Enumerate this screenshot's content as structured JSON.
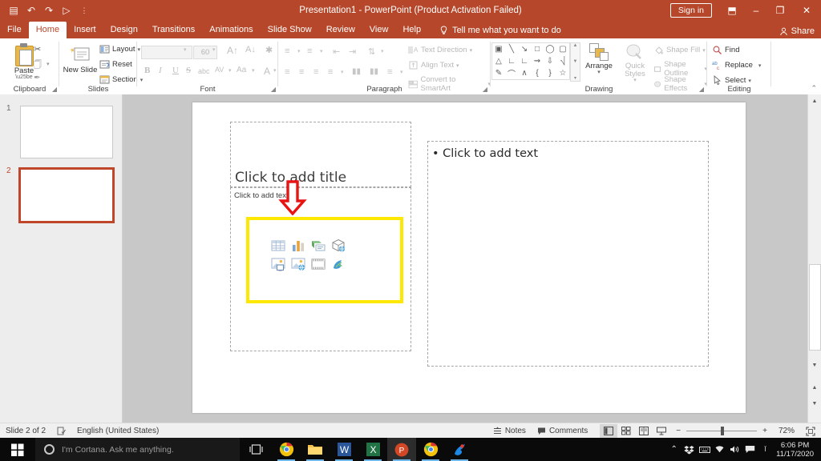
{
  "titlebar": {
    "title": "Presentation1  -  PowerPoint (Product Activation Failed)",
    "signin_label": "Sign in",
    "qat": [
      {
        "name": "save-icon",
        "glyph": "▤"
      },
      {
        "name": "undo-icon",
        "glyph": "↶"
      },
      {
        "name": "redo-icon",
        "glyph": "↷"
      },
      {
        "name": "start-from-beginning-icon",
        "glyph": "▷"
      },
      {
        "name": "customize-quick-access-toolbar-icon",
        "glyph": "⋮"
      }
    ],
    "ribbon_display_options": "⬒",
    "minimize": "–",
    "restore": "❐",
    "close": "✕"
  },
  "tabs": [
    {
      "label": "File",
      "active": false
    },
    {
      "label": "Home",
      "active": true
    },
    {
      "label": "Insert",
      "active": false
    },
    {
      "label": "Design",
      "active": false
    },
    {
      "label": "Transitions",
      "active": false
    },
    {
      "label": "Animations",
      "active": false
    },
    {
      "label": "Slide Show",
      "active": false
    },
    {
      "label": "Review",
      "active": false
    },
    {
      "label": "View",
      "active": false
    },
    {
      "label": "Help",
      "active": false
    }
  ],
  "tellme": {
    "placeholder": "Tell me what you want to do"
  },
  "share": {
    "label": "Share"
  },
  "ribbon": {
    "groups": [
      {
        "name": "clipboard",
        "label": "Clipboard"
      },
      {
        "name": "slides",
        "label": "Slides"
      },
      {
        "name": "font",
        "label": "Font"
      },
      {
        "name": "paragraph",
        "label": "Paragraph"
      },
      {
        "name": "drawing",
        "label": "Drawing"
      },
      {
        "name": "editing",
        "label": "Editing"
      }
    ],
    "clipboard": {
      "paste_label": "Paste",
      "cut_label": "Cut",
      "copy_label": "Copy",
      "format_painter_label": "Format Painter"
    },
    "slides": {
      "new_slide_label": "New Slide",
      "layout_label": "Layout",
      "reset_label": "Reset",
      "section_label": "Section"
    },
    "font": {
      "font_name_value": "",
      "font_size_value": "60",
      "increase_font_label": "A",
      "decrease_font_label": "A",
      "clear_formatting_label": "Clear All Formatting",
      "bold_label": "B",
      "italic_label": "I",
      "underline_label": "U",
      "strikethrough_label": "S",
      "shadow_label": "abc",
      "character_spacing_label": "AV",
      "change_case_label": "Aa",
      "font_color_label": "A"
    },
    "paragraph": {
      "text_direction_label": "Text Direction",
      "align_text_label": "Align Text",
      "convert_to_smartart_label": "Convert to SmartArt"
    },
    "drawing": {
      "arrange_label": "Arrange",
      "quick_styles_label": "Quick Styles",
      "shape_fill_label": "Shape Fill",
      "shape_outline_label": "Shape Outline",
      "shape_effects_label": "Shape Effects"
    },
    "editing": {
      "find_label": "Find",
      "replace_label": "Replace",
      "select_label": "Select"
    }
  },
  "thumbnails": [
    {
      "number": "1",
      "selected": false
    },
    {
      "number": "2",
      "selected": true
    }
  ],
  "slide": {
    "title_placeholder": "Click to add title",
    "subtitle_placeholder": "Click to add text",
    "content_placeholder": "• Click to add text",
    "content_icons": [
      {
        "name": "insert-table-icon"
      },
      {
        "name": "insert-chart-icon"
      },
      {
        "name": "insert-smartart-icon"
      },
      {
        "name": "insert-3d-model-icon"
      },
      {
        "name": "insert-pictures-icon"
      },
      {
        "name": "insert-online-pictures-icon"
      },
      {
        "name": "insert-video-icon"
      },
      {
        "name": "insert-icons-icon"
      }
    ],
    "annotation": {
      "type": "red-down-arrow",
      "highlight_color": "#ffe800",
      "arrow_color": "#e81313"
    }
  },
  "statusbar": {
    "slide_count": "Slide 2 of 2",
    "language": "English (United States)",
    "notes_label": "Notes",
    "comments_label": "Comments",
    "zoom_value": "72%",
    "zoom_out": "−",
    "zoom_in": "+",
    "views": [
      {
        "name": "normal-view",
        "active": true
      },
      {
        "name": "slide-sorter-view",
        "active": false
      },
      {
        "name": "reading-view",
        "active": false
      },
      {
        "name": "slide-show-view",
        "active": false
      }
    ]
  },
  "taskbar": {
    "cortana_placeholder": "I'm Cortana. Ask me anything.",
    "apps": [
      {
        "name": "chrome-taskbar-icon",
        "active": false
      },
      {
        "name": "file-explorer-taskbar-icon",
        "active": false
      },
      {
        "name": "word-taskbar-icon",
        "active": false
      },
      {
        "name": "excel-taskbar-icon",
        "active": false
      },
      {
        "name": "powerpoint-taskbar-icon",
        "active": true
      },
      {
        "name": "chrome-second-taskbar-icon",
        "active": false
      },
      {
        "name": "paint3d-taskbar-icon",
        "active": false
      }
    ],
    "tray": [
      {
        "name": "show-hidden-icons",
        "glyph": "⌃"
      },
      {
        "name": "dropbox-tray-icon",
        "glyph": "♣"
      },
      {
        "name": "keyboard-tray-icon",
        "glyph": "⌨"
      },
      {
        "name": "network-tray-icon",
        "glyph": "◠"
      },
      {
        "name": "volume-tray-icon",
        "glyph": "◂"
      },
      {
        "name": "action-center-icon",
        "glyph": "▤"
      },
      {
        "name": "language-tray-icon",
        "glyph": "Ї"
      }
    ],
    "time": "6:06 PM",
    "date": "11/17/2020"
  }
}
